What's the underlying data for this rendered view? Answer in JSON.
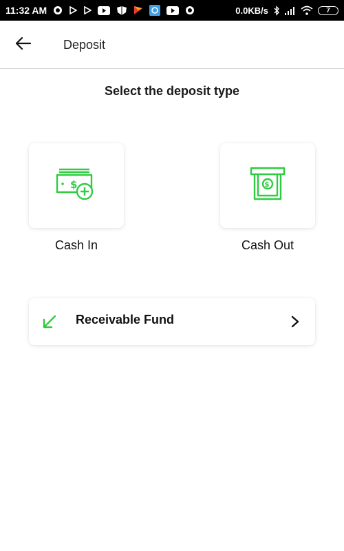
{
  "status_bar": {
    "time": "11:32 AM",
    "network_speed": "0.0KB/s",
    "battery_level": "7"
  },
  "header": {
    "title": "Deposit",
    "back_icon": "arrow-left-icon"
  },
  "main": {
    "subtitle": "Select the deposit type",
    "options": [
      {
        "label": "Cash In",
        "icon": "cash-plus-icon"
      },
      {
        "label": "Cash Out",
        "icon": "atm-cash-icon"
      }
    ],
    "receivable": {
      "label": "Receivable Fund",
      "icon": "arrow-down-left-icon",
      "chevron": "chevron-right-icon"
    }
  },
  "colors": {
    "accent": "#2ecc40",
    "text": "#111111",
    "divider": "#d8d8d8"
  }
}
